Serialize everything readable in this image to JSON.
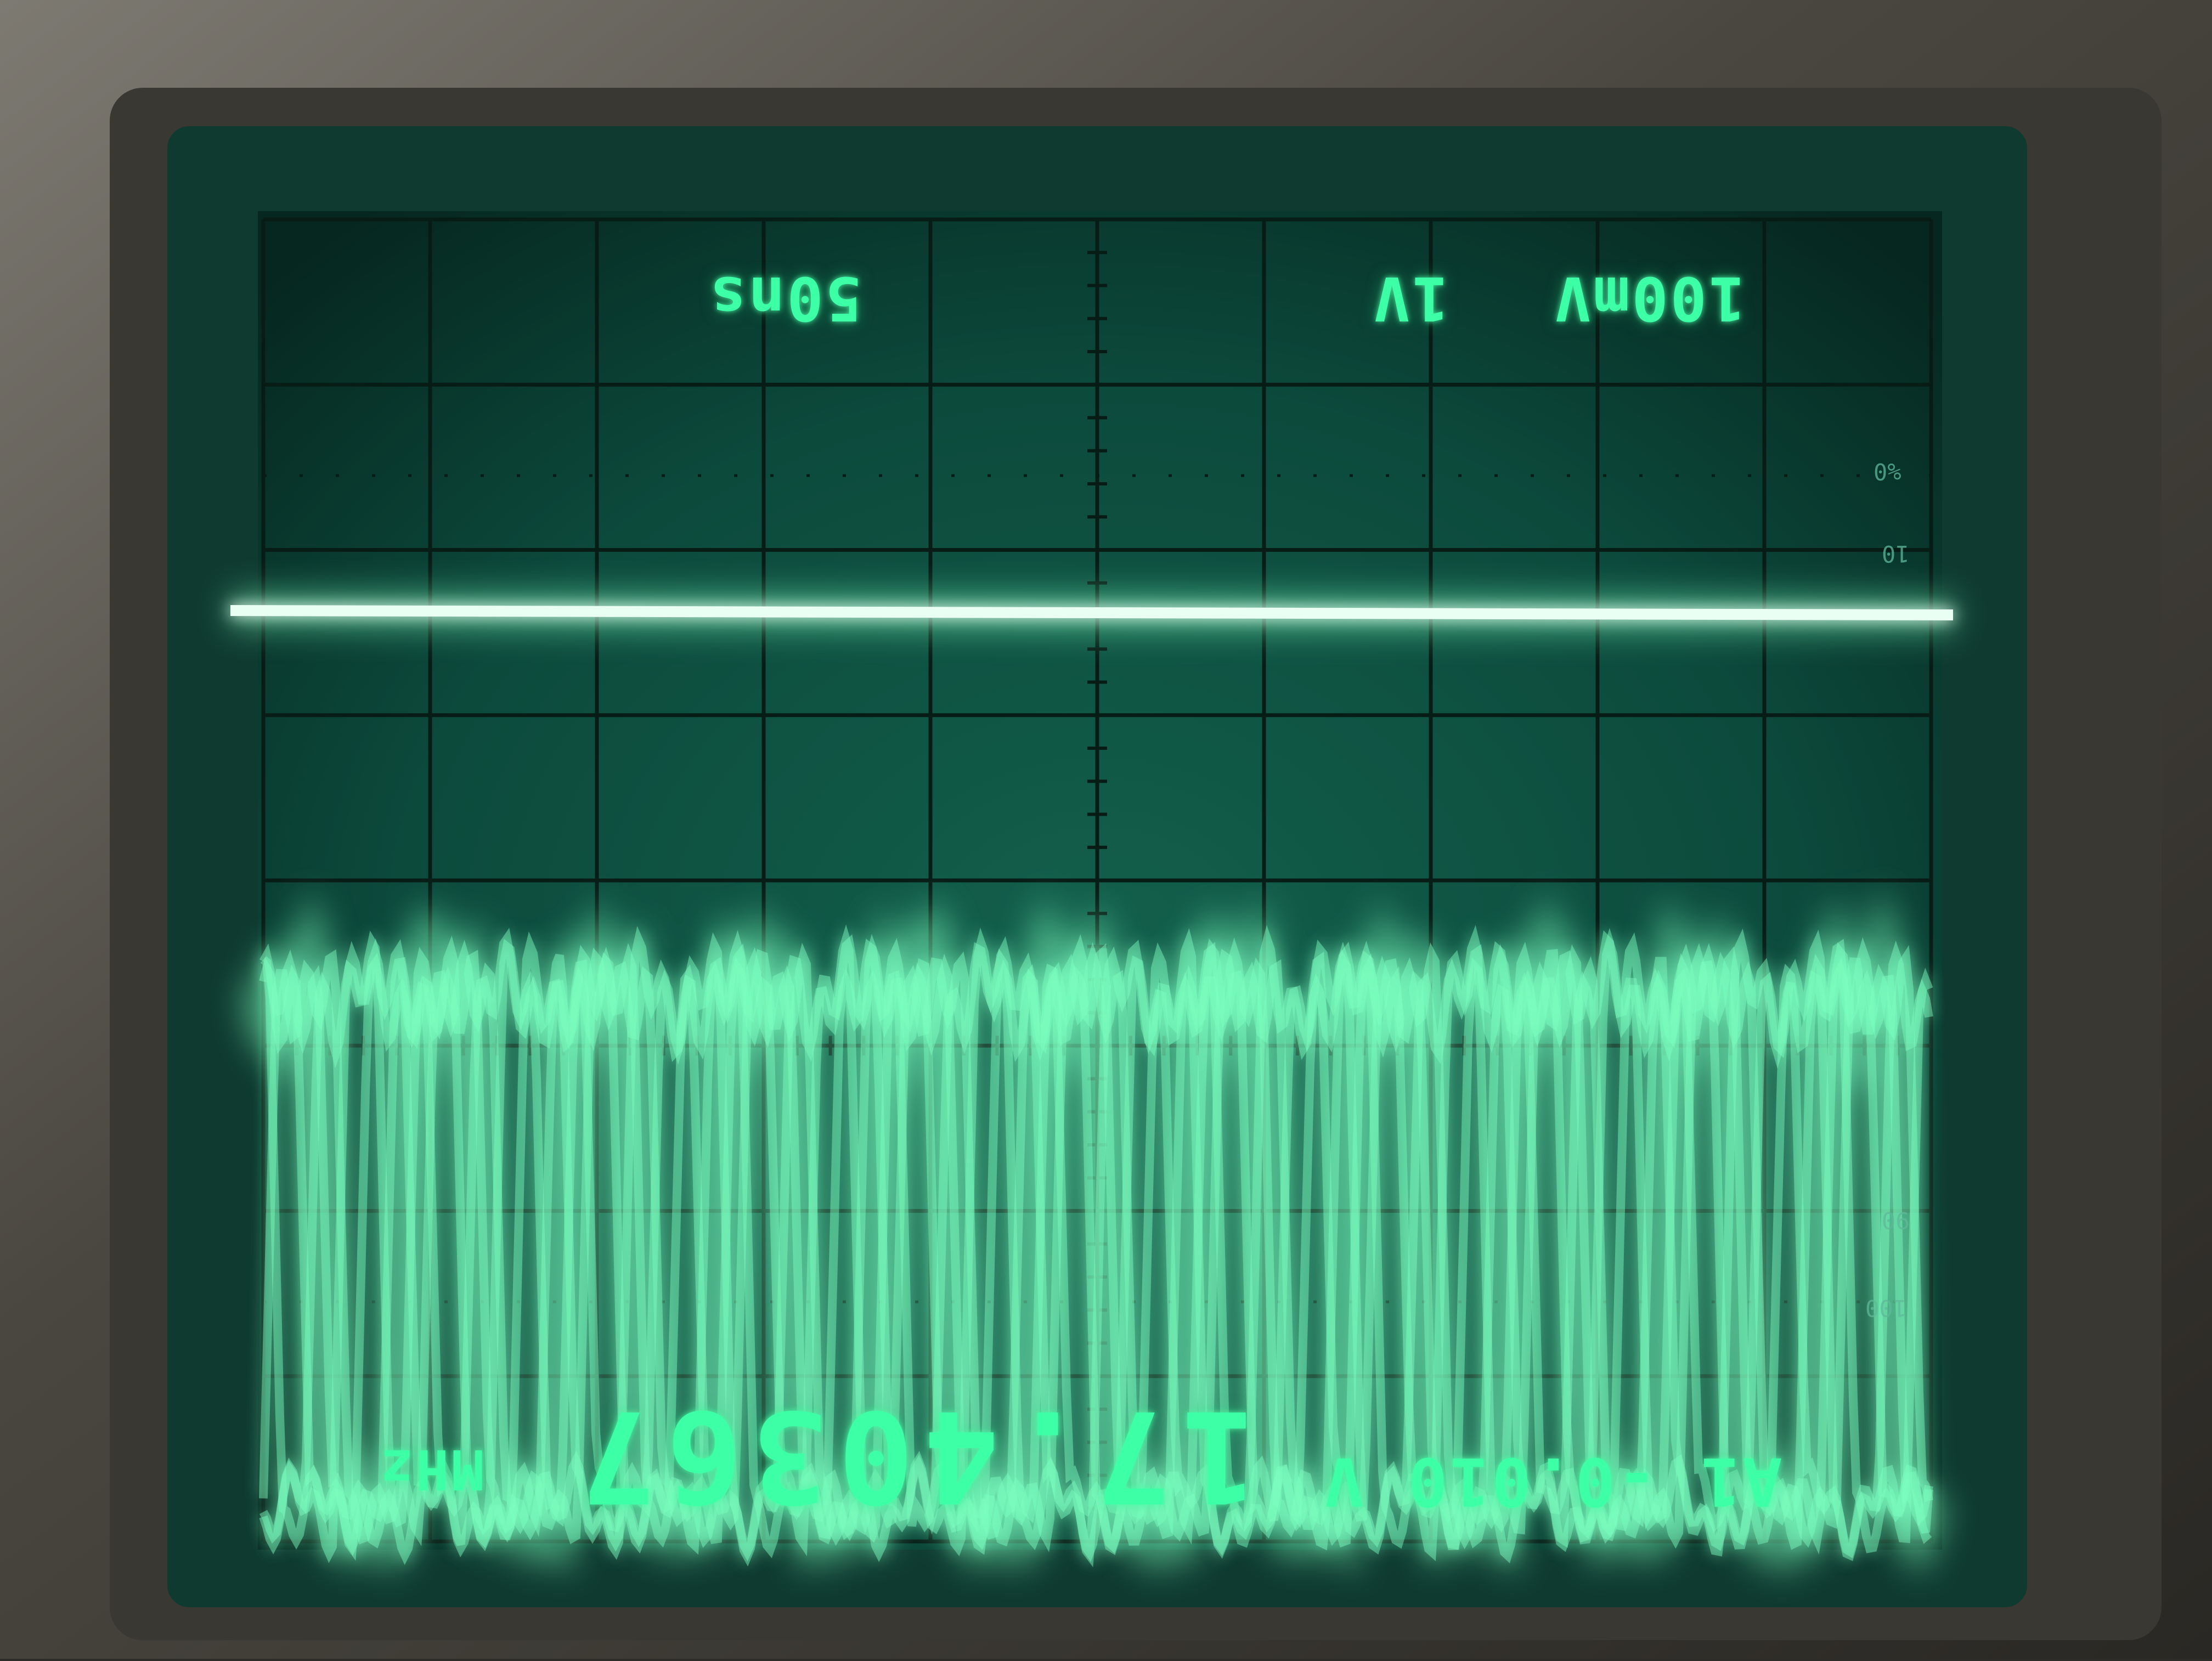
{
  "readouts": {
    "timebase": "50ns",
    "ch1_scale": "100mV",
    "ch2_scale": "1V",
    "frequency_value": "17.40367",
    "frequency_unit": "MHz",
    "cursor": "A1 -0.010 V"
  },
  "graticule_marks": {
    "pct": "%0",
    "ten": "10",
    "ninety": "90",
    "hundred": "100"
  },
  "colors": {
    "trace": "#7dffc0",
    "screen": "#0c4a3c",
    "bezel": "#0f3a30",
    "grid": "#081c16"
  }
}
